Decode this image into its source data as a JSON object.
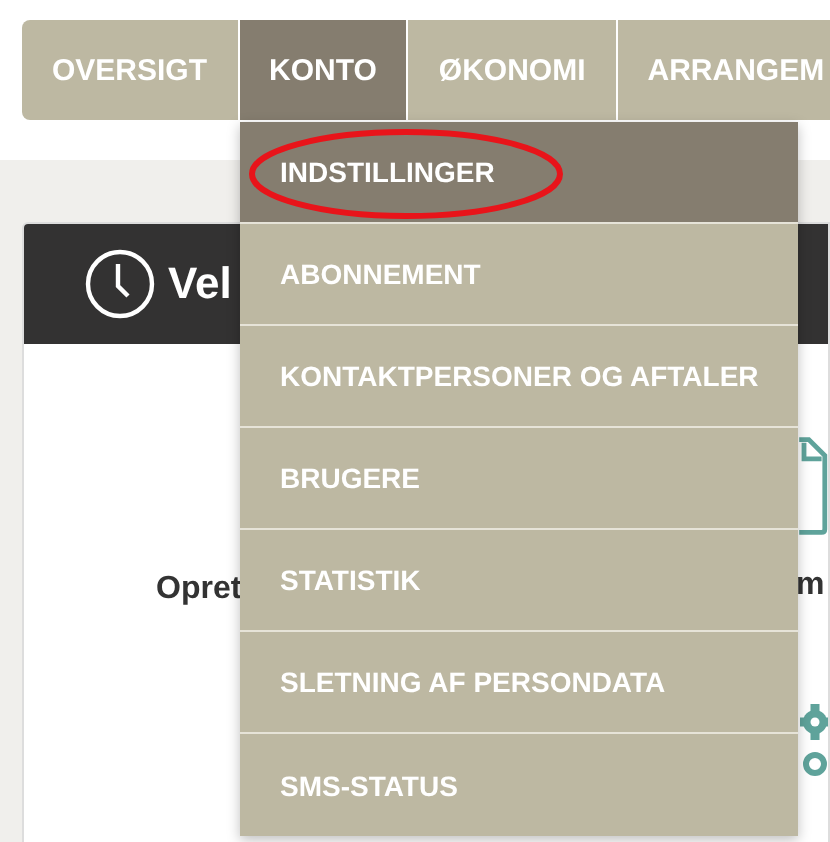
{
  "nav": {
    "tabs": [
      {
        "label": "OVERSIGT",
        "selected": false
      },
      {
        "label": "KONTO",
        "selected": true
      },
      {
        "label": "ØKONOMI",
        "selected": false
      },
      {
        "label": "ARRANGEM",
        "selected": false
      }
    ]
  },
  "dropdown": {
    "items": [
      {
        "label": "INDSTILLINGER",
        "selected": true,
        "circled": true
      },
      {
        "label": "ABONNEMENT",
        "selected": false,
        "circled": false
      },
      {
        "label": "KONTAKTPERSONER OG AFTALER",
        "selected": false,
        "circled": false
      },
      {
        "label": "BRUGERE",
        "selected": false,
        "circled": false
      },
      {
        "label": "STATISTIK",
        "selected": false,
        "circled": false
      },
      {
        "label": "SLETNING AF PERSONDATA",
        "selected": false,
        "circled": false
      },
      {
        "label": "SMS-STATUS",
        "selected": false,
        "circled": false
      }
    ]
  },
  "card": {
    "title": "Vel",
    "left_label": "Opret",
    "right_label": "m"
  }
}
